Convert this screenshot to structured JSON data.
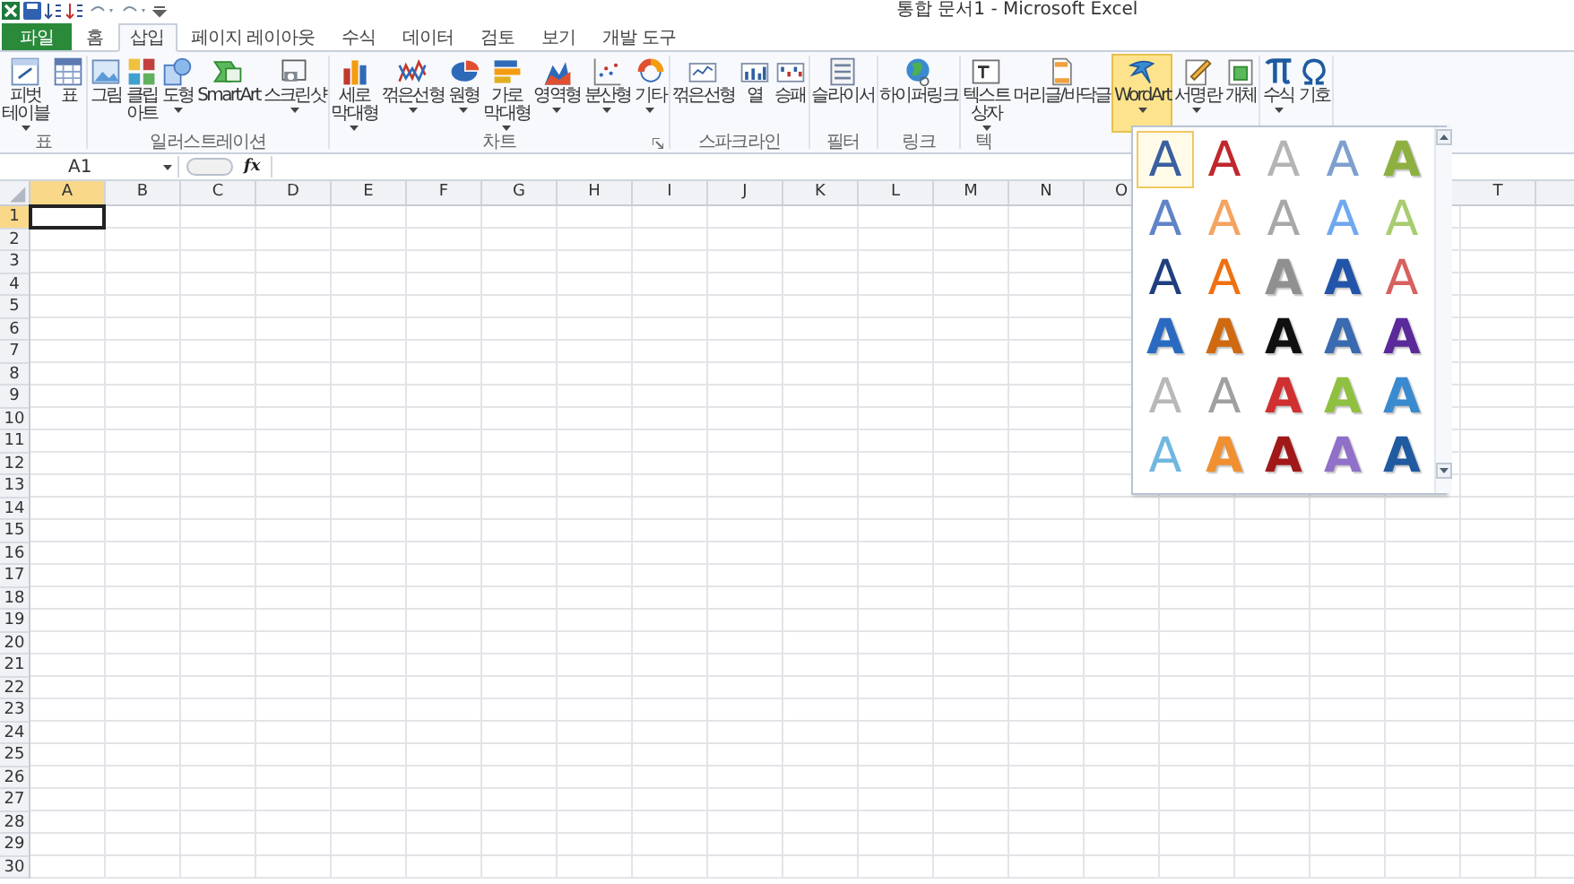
{
  "window": {
    "title": "통합 문서1 - Microsoft Excel"
  },
  "tabs": [
    {
      "label": "파일",
      "kind": "file",
      "selected": false
    },
    {
      "label": "홈",
      "kind": "tab",
      "selected": false
    },
    {
      "label": "삽입",
      "kind": "tab",
      "selected": true
    },
    {
      "label": "페이지 레이아웃",
      "kind": "tab",
      "selected": false
    },
    {
      "label": "수식",
      "kind": "tab",
      "selected": false
    },
    {
      "label": "데이터",
      "kind": "tab",
      "selected": false
    },
    {
      "label": "검토",
      "kind": "tab",
      "selected": false
    },
    {
      "label": "보기",
      "kind": "tab",
      "selected": false
    },
    {
      "label": "개발 도구",
      "kind": "tab",
      "selected": false
    }
  ],
  "ribbon": {
    "groups": [
      {
        "label": "표",
        "launcher": false,
        "buttons": [
          {
            "label": "피벗\n테이블",
            "dropdown": true,
            "selected": false
          },
          {
            "label": "표",
            "dropdown": false,
            "selected": false
          }
        ]
      },
      {
        "label": "일러스트레이션",
        "launcher": false,
        "buttons": [
          {
            "label": "그림",
            "dropdown": false,
            "selected": false
          },
          {
            "label": "클립\n아트",
            "dropdown": false,
            "selected": false
          },
          {
            "label": "도형",
            "dropdown": true,
            "selected": false
          },
          {
            "label": "SmartArt",
            "dropdown": false,
            "selected": false
          },
          {
            "label": "스크린샷",
            "dropdown": true,
            "selected": false
          }
        ]
      },
      {
        "label": "차트",
        "launcher": true,
        "buttons": [
          {
            "label": "세로\n막대형",
            "dropdown": true,
            "selected": false
          },
          {
            "label": "꺾은선형",
            "dropdown": true,
            "selected": false
          },
          {
            "label": "원형",
            "dropdown": true,
            "selected": false
          },
          {
            "label": "가로\n막대형",
            "dropdown": true,
            "selected": false
          },
          {
            "label": "영역형",
            "dropdown": true,
            "selected": false
          },
          {
            "label": "분산형",
            "dropdown": true,
            "selected": false
          },
          {
            "label": "기타",
            "dropdown": true,
            "selected": false
          }
        ]
      },
      {
        "label": "스파크라인",
        "launcher": false,
        "buttons": [
          {
            "label": "꺾은선형",
            "dropdown": false,
            "selected": false
          },
          {
            "label": "열",
            "dropdown": false,
            "selected": false
          },
          {
            "label": "승패",
            "dropdown": false,
            "selected": false
          }
        ]
      },
      {
        "label": "필터",
        "launcher": false,
        "buttons": [
          {
            "label": "슬라이서",
            "dropdown": false,
            "selected": false
          }
        ]
      },
      {
        "label": "링크",
        "launcher": false,
        "buttons": [
          {
            "label": "하이퍼링크",
            "dropdown": false,
            "selected": false
          }
        ]
      },
      {
        "label": "텍",
        "launcher": false,
        "buttons": [
          {
            "label": "텍스트\n상자",
            "dropdown": true,
            "selected": false
          },
          {
            "label": "머리글/바닥글",
            "dropdown": false,
            "selected": false
          },
          {
            "label": "WordArt",
            "dropdown": true,
            "selected": true
          },
          {
            "label": "서명란",
            "dropdown": true,
            "selected": false
          },
          {
            "label": "개체",
            "dropdown": false,
            "selected": false
          }
        ]
      },
      {
        "buttons": [
          {
            "label": "수식",
            "dropdown": true,
            "selected": false
          },
          {
            "label": "기호",
            "dropdown": false,
            "selected": false
          }
        ]
      }
    ]
  },
  "formula_bar": {
    "name_box": "A1",
    "function_button": "fx"
  },
  "sheet": {
    "columns": [
      {
        "label": "A",
        "selected": true
      },
      {
        "label": "B",
        "selected": false
      },
      {
        "label": "C",
        "selected": false
      },
      {
        "label": "D",
        "selected": false
      },
      {
        "label": "E",
        "selected": false
      },
      {
        "label": "F",
        "selected": false
      },
      {
        "label": "G",
        "selected": false
      },
      {
        "label": "H",
        "selected": false
      },
      {
        "label": "I",
        "selected": false
      },
      {
        "label": "J",
        "selected": false
      },
      {
        "label": "K",
        "selected": false
      },
      {
        "label": "L",
        "selected": false
      },
      {
        "label": "M",
        "selected": false
      },
      {
        "label": "N",
        "selected": false
      },
      {
        "label": "O",
        "selected": false
      }
    ],
    "right_columns": [
      {
        "label": "T",
        "selected": false
      }
    ],
    "rows": [
      {
        "label": "1",
        "selected": true
      },
      {
        "label": "2",
        "selected": false
      },
      {
        "label": "3",
        "selected": false
      },
      {
        "label": "4",
        "selected": false
      },
      {
        "label": "5",
        "selected": false
      },
      {
        "label": "6",
        "selected": false
      },
      {
        "label": "7",
        "selected": false
      },
      {
        "label": "8",
        "selected": false
      },
      {
        "label": "9",
        "selected": false
      },
      {
        "label": "10",
        "selected": false
      },
      {
        "label": "11",
        "selected": false
      },
      {
        "label": "12",
        "selected": false
      },
      {
        "label": "13",
        "selected": false
      },
      {
        "label": "14",
        "selected": false
      },
      {
        "label": "15",
        "selected": false
      },
      {
        "label": "16",
        "selected": false
      },
      {
        "label": "17",
        "selected": false
      },
      {
        "label": "18",
        "selected": false
      },
      {
        "label": "19",
        "selected": false
      },
      {
        "label": "20",
        "selected": false
      },
      {
        "label": "21",
        "selected": false
      },
      {
        "label": "22",
        "selected": false
      },
      {
        "label": "23",
        "selected": false
      },
      {
        "label": "24",
        "selected": false
      },
      {
        "label": "25",
        "selected": false
      },
      {
        "label": "26",
        "selected": false
      },
      {
        "label": "27",
        "selected": false
      },
      {
        "label": "28",
        "selected": false
      },
      {
        "label": "29",
        "selected": false
      },
      {
        "label": "30",
        "selected": false
      }
    ]
  },
  "wordart_gallery": {
    "items": [
      {
        "text": "A",
        "kind": "outline",
        "color": "#3b5fa0",
        "selected": true
      },
      {
        "text": "A",
        "kind": "outline",
        "color": "#c0272d",
        "selected": false
      },
      {
        "text": "A",
        "kind": "outline",
        "color": "#b4b4b4",
        "selected": false
      },
      {
        "text": "A",
        "kind": "outline",
        "color": "#7f9fcf",
        "selected": false
      },
      {
        "text": "A",
        "kind": "solid",
        "color": "#8db040",
        "selected": false
      },
      {
        "text": "A",
        "kind": "outline",
        "color": "#5f84c8",
        "selected": false
      },
      {
        "text": "A",
        "kind": "outline",
        "color": "#f4a460",
        "selected": false
      },
      {
        "text": "A",
        "kind": "outline",
        "color": "#a8a8a8",
        "selected": false
      },
      {
        "text": "A",
        "kind": "outline",
        "color": "#6fa8f0",
        "selected": false
      },
      {
        "text": "A",
        "kind": "outline",
        "color": "#a8cc70",
        "selected": false
      },
      {
        "text": "A",
        "kind": "outline",
        "color": "#1f3f7f",
        "selected": false
      },
      {
        "text": "A",
        "kind": "outline",
        "color": "#f07010",
        "selected": false
      },
      {
        "text": "A",
        "kind": "solid",
        "color": "#909090",
        "selected": false
      },
      {
        "text": "A",
        "kind": "solid",
        "color": "#2255aa",
        "selected": false
      },
      {
        "text": "A",
        "kind": "outline",
        "color": "#d86060",
        "selected": false
      },
      {
        "text": "A",
        "kind": "solid",
        "color": "#2a6ac0",
        "selected": false
      },
      {
        "text": "A",
        "kind": "solid",
        "color": "#d06a10",
        "selected": false
      },
      {
        "text": "A",
        "kind": "solid",
        "color": "#101010",
        "selected": false
      },
      {
        "text": "A",
        "kind": "solid",
        "color": "#3a6ab0",
        "selected": false
      },
      {
        "text": "A",
        "kind": "solid",
        "color": "#5a2a9a",
        "selected": false
      },
      {
        "text": "A",
        "kind": "outline",
        "color": "#b8b8b8",
        "selected": false
      },
      {
        "text": "A",
        "kind": "outline",
        "color": "#a0a0a0",
        "selected": false
      },
      {
        "text": "A",
        "kind": "solid",
        "color": "#d03030",
        "selected": false
      },
      {
        "text": "A",
        "kind": "solid",
        "color": "#90c040",
        "selected": false
      },
      {
        "text": "A",
        "kind": "solid",
        "color": "#3a8ad0",
        "selected": false
      },
      {
        "text": "A",
        "kind": "outline",
        "color": "#70b8e0",
        "selected": false
      },
      {
        "text": "A",
        "kind": "solid",
        "color": "#f09030",
        "selected": false
      },
      {
        "text": "A",
        "kind": "solid",
        "color": "#a01818",
        "selected": false
      },
      {
        "text": "A",
        "kind": "solid",
        "color": "#9070c8",
        "selected": false
      },
      {
        "text": "A",
        "kind": "solid",
        "color": "#205aa0",
        "selected": false
      }
    ]
  }
}
